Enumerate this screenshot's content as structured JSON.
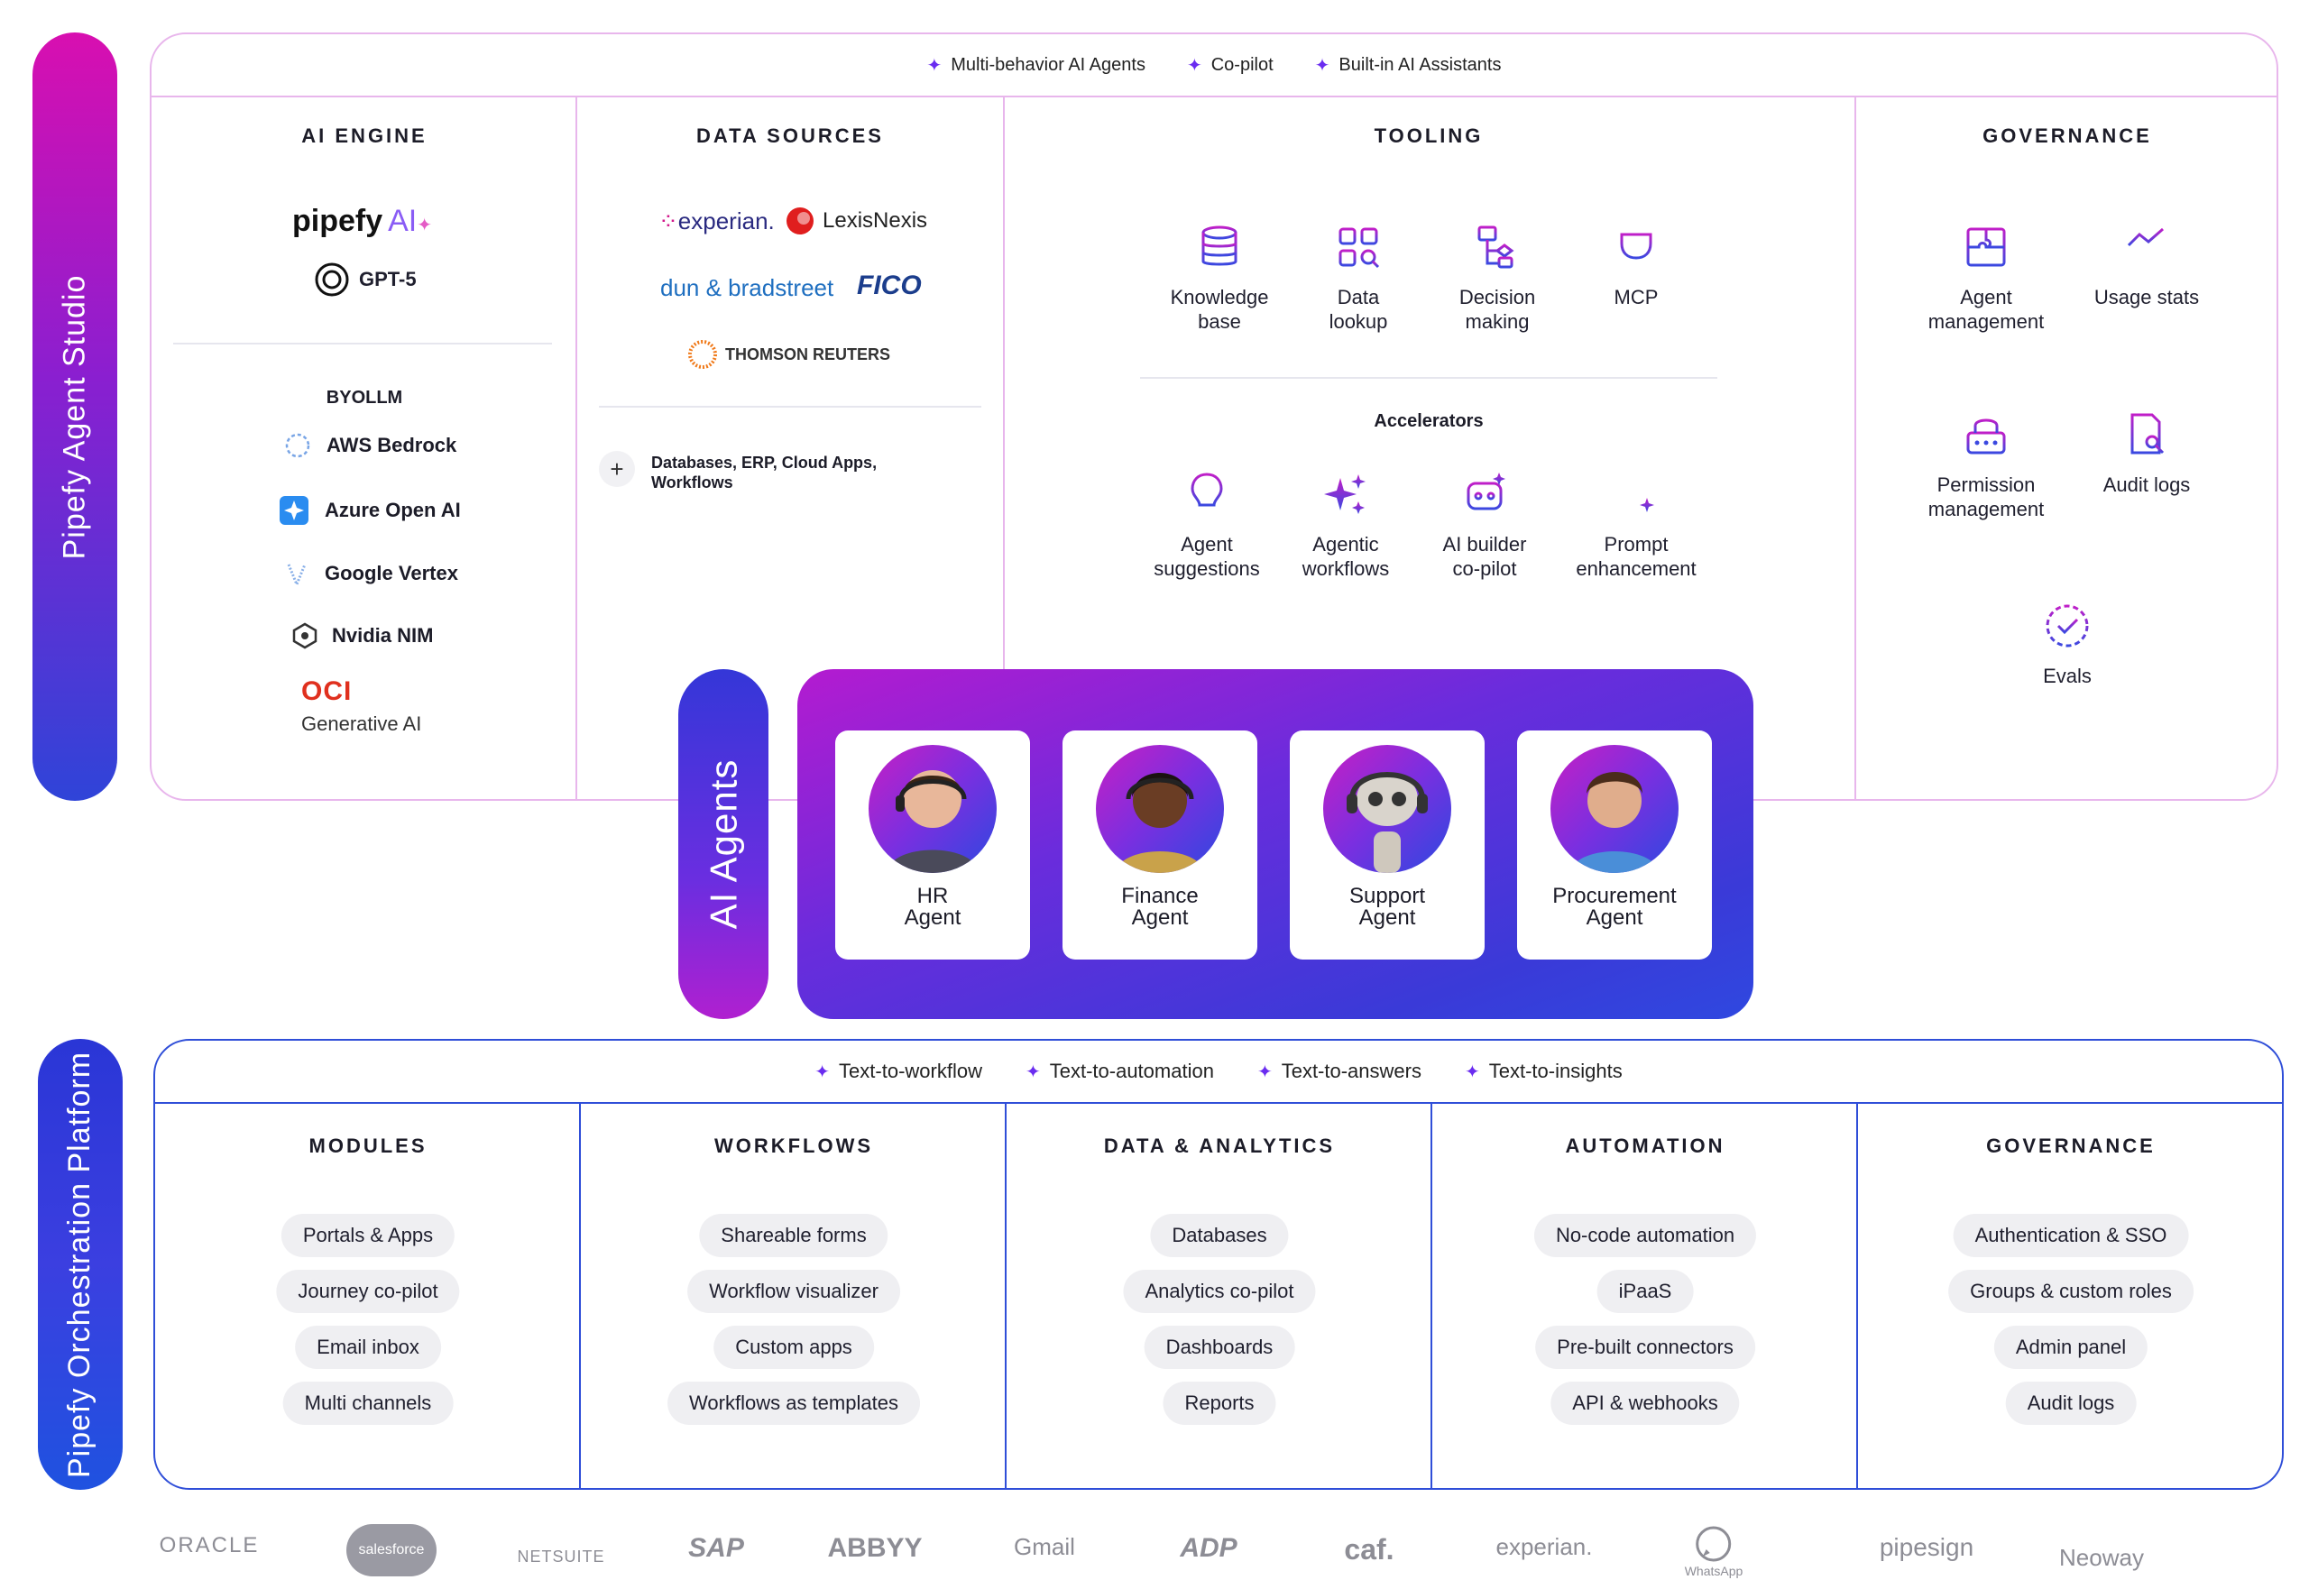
{
  "studio": {
    "label": "Pipefy Agent Studio",
    "top_features": [
      "Multi-behavior AI Agents",
      "Co-pilot",
      "Built-in AI Assistants"
    ],
    "ai_engine": {
      "title": "AI ENGINE",
      "logos": [
        "pipefy",
        "AI",
        "GPT-5"
      ],
      "byollm_title": "BYOLLM",
      "byollm": [
        "AWS Bedrock",
        "Azure Open AI",
        "Google Vertex",
        "Nvidia NIM"
      ],
      "oci": "OCI",
      "oci_sub": "Generative AI"
    },
    "data_sources": {
      "title": "DATA SOURCES",
      "logos": [
        "experian.",
        "LexisNexis",
        "dun & bradstreet",
        "FICO",
        "THOMSON REUTERS"
      ],
      "more": "Databases, ERP, Cloud Apps, Workflows"
    },
    "tooling": {
      "title": "TOOLING",
      "items": [
        {
          "icon": "database-icon",
          "label": "Knowledge base"
        },
        {
          "icon": "grid-search-icon",
          "label": "Data lookup"
        },
        {
          "icon": "flowchart-icon",
          "label": "Decision making"
        },
        {
          "icon": "plug-icon",
          "label": "MCP"
        }
      ],
      "accelerators_title": "Accelerators",
      "accelerators": [
        {
          "icon": "lightbulb-icon",
          "label": "Agent suggestions"
        },
        {
          "icon": "sparkles-icon",
          "label": "Agentic workflows"
        },
        {
          "icon": "robot-icon",
          "label": "AI builder co-pilot"
        },
        {
          "icon": "prompt-icon",
          "label": "Prompt enhancement"
        }
      ]
    },
    "governance": {
      "title": "GOVERNANCE",
      "items": [
        {
          "icon": "puzzle-icon",
          "label": "Agent management"
        },
        {
          "icon": "chart-icon",
          "label": "Usage stats"
        },
        {
          "icon": "lock-icon",
          "label": "Permission management"
        },
        {
          "icon": "audit-icon",
          "label": "Audit logs"
        },
        {
          "icon": "check-circle-icon",
          "label": "Evals"
        }
      ]
    }
  },
  "agents": {
    "label": "AI Agents",
    "cards": [
      {
        "line1": "HR",
        "line2": "Agent"
      },
      {
        "line1": "Finance",
        "line2": "Agent"
      },
      {
        "line1": "Support",
        "line2": "Agent"
      },
      {
        "line1": "Procurement",
        "line2": "Agent"
      }
    ]
  },
  "orchestration": {
    "label": "Pipefy Orchestration Platform",
    "top_features": [
      "Text-to-workflow",
      "Text-to-automation",
      "Text-to-answers",
      "Text-to-insights"
    ],
    "columns": [
      {
        "title": "MODULES",
        "chips": [
          "Portals & Apps",
          "Journey co-pilot",
          "Email inbox",
          "Multi channels"
        ]
      },
      {
        "title": "WORKFLOWS",
        "chips": [
          "Shareable forms",
          "Workflow visualizer",
          "Custom apps",
          "Workflows as templates"
        ]
      },
      {
        "title": "DATA & ANALYTICS",
        "chips": [
          "Databases",
          "Analytics co-pilot",
          "Dashboards",
          "Reports"
        ]
      },
      {
        "title": "AUTOMATION",
        "chips": [
          "No-code automation",
          "iPaaS",
          "Pre-built connectors",
          "API & webhooks"
        ]
      },
      {
        "title": "GOVERNANCE",
        "chips": [
          "Authentication & SSO",
          "Groups & custom roles",
          "Admin panel",
          "Audit logs"
        ]
      }
    ]
  },
  "partners": [
    "ORACLE",
    "salesforce",
    "NETSUITE",
    "SAP",
    "ABBYY",
    "Gmail",
    "ADP",
    "caf.",
    "experian.",
    "WhatsApp",
    "pipesign",
    "Neoway"
  ],
  "colors": {
    "magenta": "#d80fb0",
    "purple": "#6a2cf0",
    "blue": "#2f4ed8",
    "border_pink": "#e8b6ec"
  }
}
